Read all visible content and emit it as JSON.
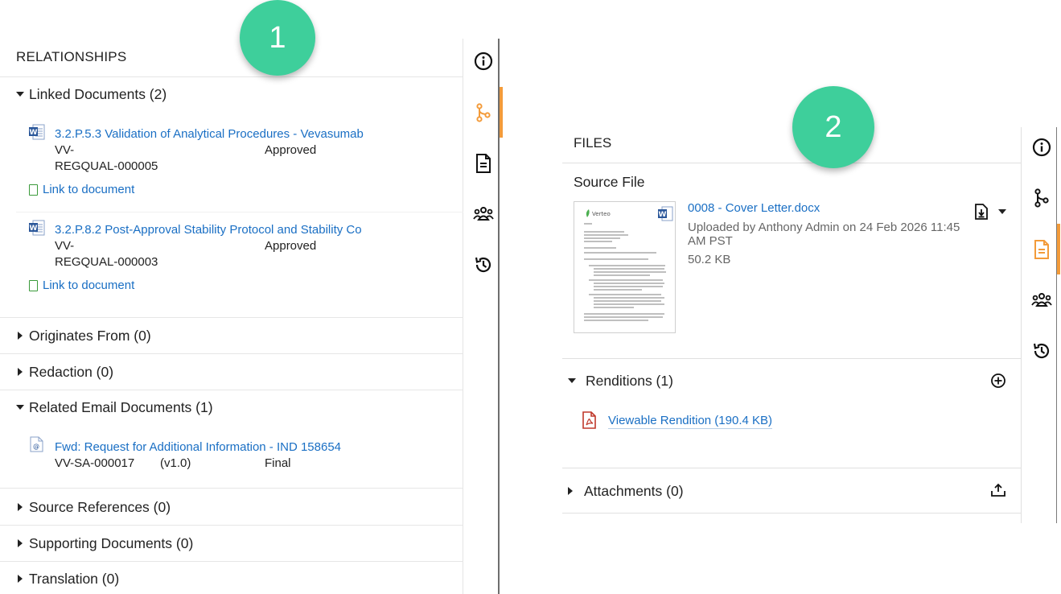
{
  "left_panel": {
    "title": "RELATIONSHIPS",
    "linked_documents": {
      "header": "Linked Documents (2)",
      "items": [
        {
          "title": "3.2.P.5.3 Validation of Analytical Procedures - Vevasumab",
          "number_line1": "VV-",
          "number_line2": "REGQUAL-000005",
          "status": "Approved",
          "link_label": "Link to document"
        },
        {
          "title": "3.2.P.8.2 Post-Approval Stability Protocol and Stability Co",
          "number_line1": "VV-",
          "number_line2": "REGQUAL-000003",
          "status": "Approved",
          "link_label": "Link to document"
        }
      ]
    },
    "originates_from": "Originates From (0)",
    "redaction": "Redaction (0)",
    "related_email": {
      "header": "Related Email Documents (1)",
      "items": [
        {
          "title": "Fwd: Request for Additional Information - IND 158654",
          "number": "VV-SA-000017",
          "version": "(v1.0)",
          "status": "Final"
        }
      ]
    },
    "source_references": "Source References (0)",
    "supporting_documents": "Supporting Documents (0)",
    "translation": "Translation (0)"
  },
  "right_panel": {
    "title": "FILES",
    "source_file_label": "Source File",
    "file": {
      "name": "0008 - Cover Letter.docx",
      "uploaded": "Uploaded by Anthony Admin on 24 Feb 2026 11:45 AM PST",
      "size": "50.2 KB",
      "thumbnail_brand": "Verteo"
    },
    "renditions": {
      "header": "Renditions (1)",
      "item": "Viewable Rendition (190.4 KB)"
    },
    "attachments": "Attachments (0)"
  },
  "left_rail": {
    "icons": [
      "info-icon",
      "relationships-icon",
      "document-icon",
      "users-icon",
      "history-icon"
    ],
    "active": "relationships-icon"
  },
  "right_rail": {
    "icons": [
      "info-icon",
      "relationships-icon",
      "document-icon",
      "users-icon",
      "history-icon"
    ],
    "active": "document-icon"
  },
  "badges": {
    "one": "1",
    "two": "2"
  },
  "colors": {
    "link": "#1a6fc4",
    "active_tab": "#f39b3a",
    "badge": "#3ecf9b",
    "pdf_red": "#c0392b",
    "word_blue": "#2b579a"
  }
}
